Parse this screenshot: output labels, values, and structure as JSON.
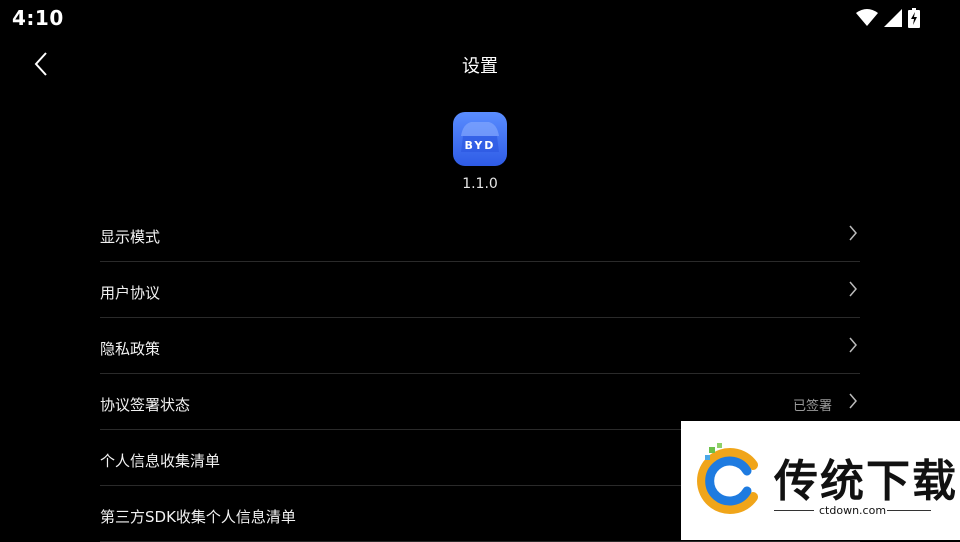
{
  "status_bar": {
    "time": "4:10",
    "icons": [
      "wifi-icon",
      "signal-icon",
      "battery-charging-icon"
    ]
  },
  "header": {
    "title": "设置",
    "back_icon": "back-arrow-icon"
  },
  "app": {
    "icon_text": "BYD",
    "version": "1.1.0",
    "icon_color": "#3f6ff2"
  },
  "menu": {
    "items": [
      {
        "label": "显示模式",
        "value": ""
      },
      {
        "label": "用户协议",
        "value": ""
      },
      {
        "label": "隐私政策",
        "value": ""
      },
      {
        "label": "协议签署状态",
        "value": "已签署"
      },
      {
        "label": "个人信息收集清单",
        "value": ""
      },
      {
        "label": "第三方SDK收集个人信息清单",
        "value": ""
      }
    ]
  },
  "watermark": {
    "text": "传统下载",
    "url": "ctdown.com"
  },
  "colors": {
    "background": "#000000",
    "text": "#ffffff",
    "divider": "#2a2a2a",
    "secondary_text": "#9a9a9a"
  }
}
